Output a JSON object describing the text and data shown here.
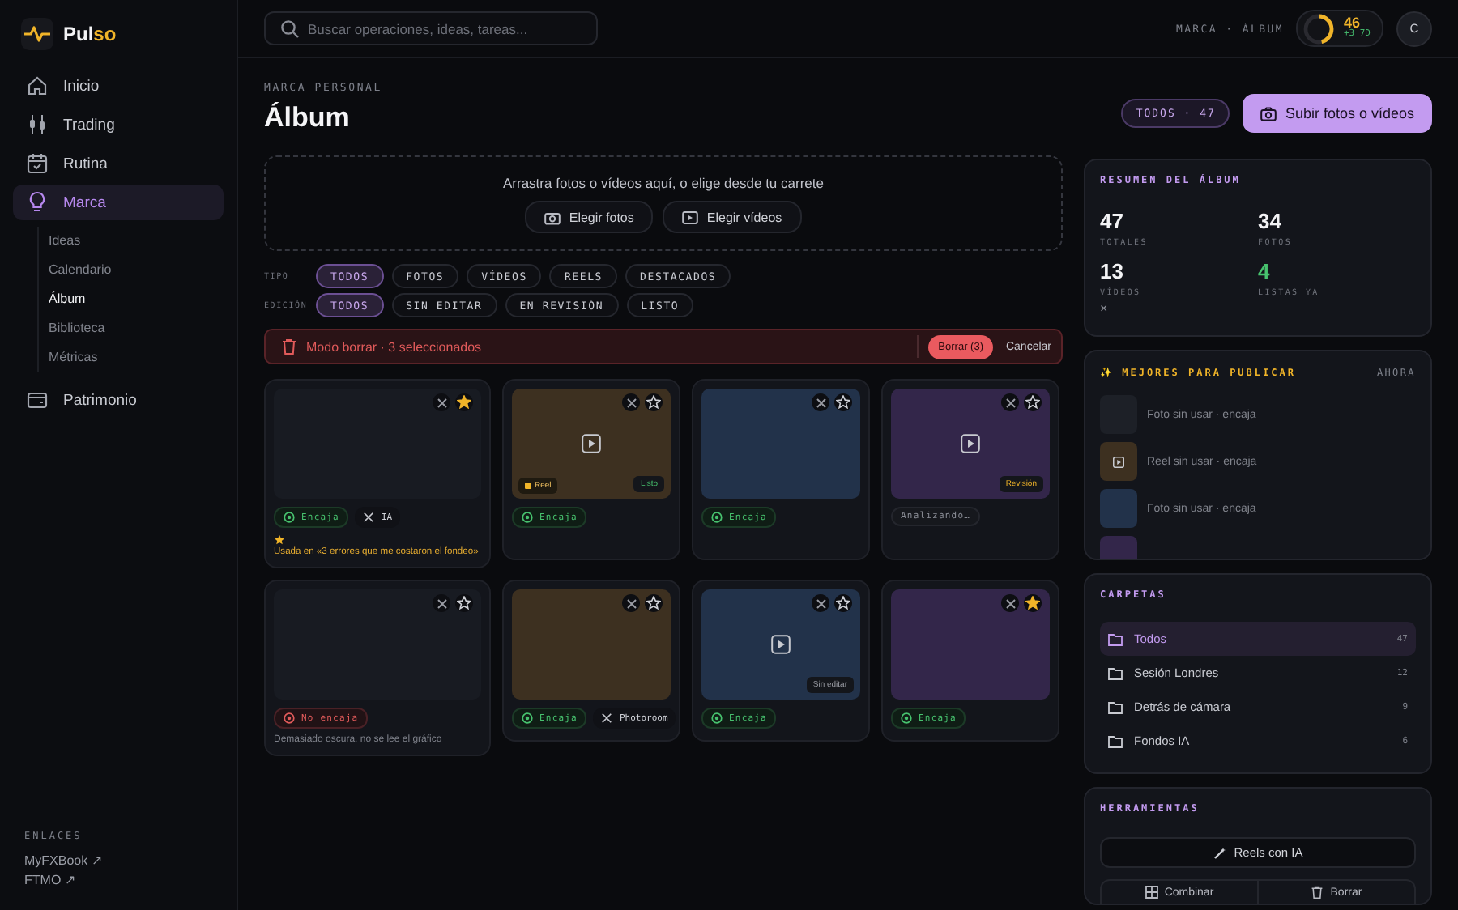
{
  "brand": {
    "name_main": "Pul",
    "name_accent": "so"
  },
  "nav": [
    {
      "label": "Inicio",
      "selected": false
    },
    {
      "label": "Trading",
      "selected": false
    },
    {
      "label": "Rutina",
      "selected": false
    },
    {
      "label": "Marca",
      "selected": true,
      "children": [
        {
          "label": "Ideas",
          "selected": false
        },
        {
          "label": "Calendario",
          "selected": false
        },
        {
          "label": "Álbum",
          "selected": true
        },
        {
          "label": "Biblioteca",
          "selected": false
        },
        {
          "label": "Métricas",
          "selected": false
        }
      ]
    },
    {
      "label": "Patrimonio",
      "selected": false
    }
  ],
  "links": {
    "title": "ENLACES",
    "items": [
      "MyFXBook ↗",
      "FTMO ↗"
    ]
  },
  "topbar": {
    "search": {
      "placeholder": "Buscar operaciones, ideas, tareas..."
    },
    "breadcrumb": "MARCA · ÁLBUM",
    "score": {
      "value": "46",
      "delta": "+3 7D",
      "level": 0.46
    },
    "avatar": "C"
  },
  "header": {
    "eyebrow": "MARCA PERSONAL",
    "title": "Álbum",
    "count_pill": "TODOS · 47",
    "upload_button": "Subir fotos o vídeos"
  },
  "dropzone": {
    "text": "Arrastra fotos o vídeos aquí, o elige desde tu carrete",
    "buttons": [
      "Elegir fotos",
      "Elegir vídeos"
    ]
  },
  "filters": [
    {
      "label": "TIPO",
      "chips": [
        {
          "label": "TODOS",
          "selected": true
        },
        {
          "label": "FOTOS",
          "selected": false
        },
        {
          "label": "VÍDEOS",
          "selected": false
        },
        {
          "label": "REELS",
          "selected": false
        },
        {
          "label": "DESTACADOS",
          "selected": false
        }
      ]
    },
    {
      "label": "EDICIÓN",
      "chips": [
        {
          "label": "TODOS",
          "selected": true
        },
        {
          "label": "SIN EDITAR",
          "selected": false
        },
        {
          "label": "EN REVISIÓN",
          "selected": false
        },
        {
          "label": "LISTO",
          "selected": false
        }
      ]
    }
  ],
  "delete_bar": {
    "text": "Modo borrar · 3 seleccionados",
    "confirm": "Borrar (3)",
    "cancel": "Cancelar"
  },
  "cards": [
    {
      "color": "#181b22",
      "video": false,
      "starred": true,
      "fit": {
        "label": "Encaja",
        "kind": "ok"
      },
      "tag": "IA",
      "usage": "Usada en «3 errores que me costaron el fondeo»"
    },
    {
      "color": "#3d3020",
      "video": true,
      "starred": false,
      "type_badge": "Reel",
      "status": {
        "label": "Listo",
        "kind": "ready"
      },
      "fit": {
        "label": "Encaja",
        "kind": "ok"
      }
    },
    {
      "color": "#22324a",
      "video": false,
      "starred": false,
      "fit": {
        "label": "Encaja",
        "kind": "ok"
      }
    },
    {
      "color": "#33264a",
      "video": true,
      "starred": false,
      "status": {
        "label": "Revisión",
        "kind": "review"
      },
      "fit": {
        "label": "Analizando…",
        "kind": "pending"
      }
    },
    {
      "color": "#181b22",
      "video": false,
      "starred": false,
      "fit": {
        "label": "No encaja",
        "kind": "bad"
      },
      "note": "Demasiado oscura, no se lee el gráfico"
    },
    {
      "color": "#3d3020",
      "video": false,
      "starred": false,
      "fit": {
        "label": "Encaja",
        "kind": "ok"
      },
      "tag": "Photoroom"
    },
    {
      "color": "#22324a",
      "video": true,
      "starred": false,
      "status": {
        "label": "Sin editar",
        "kind": "unedited"
      },
      "fit": {
        "label": "Encaja",
        "kind": "ok"
      }
    },
    {
      "color": "#33264a",
      "video": false,
      "starred": true,
      "fit": {
        "label": "Encaja",
        "kind": "ok"
      }
    }
  ],
  "summary": {
    "title": "RESUMEN DEL ÁLBUM",
    "stats": [
      {
        "value": "47",
        "label": "TOTALES",
        "highlight": false
      },
      {
        "value": "34",
        "label": "FOTOS",
        "highlight": false
      },
      {
        "value": "13",
        "label": "VÍDEOS",
        "highlight": false
      },
      {
        "value": "4",
        "label": "LISTAS YA",
        "highlight": true
      }
    ],
    "dismiss": "×"
  },
  "best": {
    "title": "✨ MEJORES PARA PUBLICAR",
    "when": "AHORA",
    "items": [
      {
        "color": "#1d2027",
        "video": false,
        "text": "Foto sin usar · encaja"
      },
      {
        "color": "#3d3020",
        "video": true,
        "text": "Reel sin usar · encaja"
      },
      {
        "color": "#22324a",
        "video": false,
        "text": "Foto sin usar · encaja"
      }
    ]
  },
  "folders": {
    "title": "CARPETAS",
    "items": [
      {
        "name": "Todos",
        "count": "47",
        "selected": true
      },
      {
        "name": "Sesión Londres",
        "count": "12",
        "selected": false
      },
      {
        "name": "Detrás de cámara",
        "count": "9",
        "selected": false
      },
      {
        "name": "Fondos IA",
        "count": "6",
        "selected": false
      }
    ]
  },
  "tools": {
    "title": "HERRAMIENTAS",
    "primary": "Reels con IA",
    "secondary": [
      "Combinar",
      "Borrar"
    ]
  }
}
